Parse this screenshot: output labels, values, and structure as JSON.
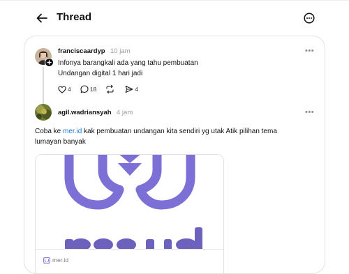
{
  "header": {
    "title": "Thread",
    "back_icon": "arrow-left-icon",
    "more_icon": "more-circle-icon"
  },
  "posts": [
    {
      "username": "franciscaardyp",
      "time": "10 jam",
      "text_lines": [
        "Infonya barangkali ada yang tahu pembuatan",
        "Undangan digital 1 hari jadi"
      ],
      "more": "•••",
      "actions": {
        "likes": "4",
        "replies": "18",
        "reposts": "",
        "shares": "4"
      }
    },
    {
      "username": "agil.wadriansyah",
      "time": "4 jam",
      "text_before_link": "Coba ke ",
      "link_text": "mer.id",
      "text_after_link": " kak pembuatan undangan kita sendiri yg utak Atik pilihan tema lumayan banyak",
      "more": "•••",
      "preview": {
        "logo_text": "merid",
        "domain": "mer.id"
      }
    }
  ],
  "colors": {
    "brand_purple": "#7c6fd6",
    "link_blue": "#1f7ad4",
    "muted": "#9a9a9a"
  }
}
